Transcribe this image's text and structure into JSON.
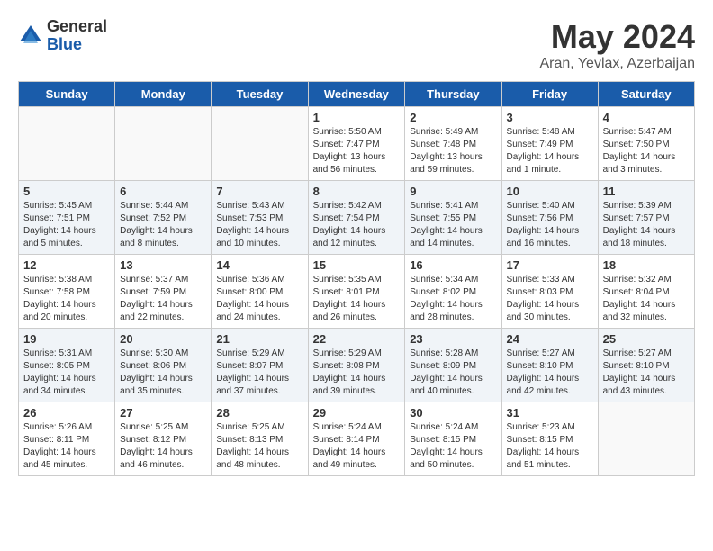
{
  "header": {
    "logo_general": "General",
    "logo_blue": "Blue",
    "month_year": "May 2024",
    "location": "Aran, Yevlax, Azerbaijan"
  },
  "weekdays": [
    "Sunday",
    "Monday",
    "Tuesday",
    "Wednesday",
    "Thursday",
    "Friday",
    "Saturday"
  ],
  "weeks": [
    [
      {
        "day": "",
        "info": ""
      },
      {
        "day": "",
        "info": ""
      },
      {
        "day": "",
        "info": ""
      },
      {
        "day": "1",
        "info": "Sunrise: 5:50 AM\nSunset: 7:47 PM\nDaylight: 13 hours\nand 56 minutes."
      },
      {
        "day": "2",
        "info": "Sunrise: 5:49 AM\nSunset: 7:48 PM\nDaylight: 13 hours\nand 59 minutes."
      },
      {
        "day": "3",
        "info": "Sunrise: 5:48 AM\nSunset: 7:49 PM\nDaylight: 14 hours\nand 1 minute."
      },
      {
        "day": "4",
        "info": "Sunrise: 5:47 AM\nSunset: 7:50 PM\nDaylight: 14 hours\nand 3 minutes."
      }
    ],
    [
      {
        "day": "5",
        "info": "Sunrise: 5:45 AM\nSunset: 7:51 PM\nDaylight: 14 hours\nand 5 minutes."
      },
      {
        "day": "6",
        "info": "Sunrise: 5:44 AM\nSunset: 7:52 PM\nDaylight: 14 hours\nand 8 minutes."
      },
      {
        "day": "7",
        "info": "Sunrise: 5:43 AM\nSunset: 7:53 PM\nDaylight: 14 hours\nand 10 minutes."
      },
      {
        "day": "8",
        "info": "Sunrise: 5:42 AM\nSunset: 7:54 PM\nDaylight: 14 hours\nand 12 minutes."
      },
      {
        "day": "9",
        "info": "Sunrise: 5:41 AM\nSunset: 7:55 PM\nDaylight: 14 hours\nand 14 minutes."
      },
      {
        "day": "10",
        "info": "Sunrise: 5:40 AM\nSunset: 7:56 PM\nDaylight: 14 hours\nand 16 minutes."
      },
      {
        "day": "11",
        "info": "Sunrise: 5:39 AM\nSunset: 7:57 PM\nDaylight: 14 hours\nand 18 minutes."
      }
    ],
    [
      {
        "day": "12",
        "info": "Sunrise: 5:38 AM\nSunset: 7:58 PM\nDaylight: 14 hours\nand 20 minutes."
      },
      {
        "day": "13",
        "info": "Sunrise: 5:37 AM\nSunset: 7:59 PM\nDaylight: 14 hours\nand 22 minutes."
      },
      {
        "day": "14",
        "info": "Sunrise: 5:36 AM\nSunset: 8:00 PM\nDaylight: 14 hours\nand 24 minutes."
      },
      {
        "day": "15",
        "info": "Sunrise: 5:35 AM\nSunset: 8:01 PM\nDaylight: 14 hours\nand 26 minutes."
      },
      {
        "day": "16",
        "info": "Sunrise: 5:34 AM\nSunset: 8:02 PM\nDaylight: 14 hours\nand 28 minutes."
      },
      {
        "day": "17",
        "info": "Sunrise: 5:33 AM\nSunset: 8:03 PM\nDaylight: 14 hours\nand 30 minutes."
      },
      {
        "day": "18",
        "info": "Sunrise: 5:32 AM\nSunset: 8:04 PM\nDaylight: 14 hours\nand 32 minutes."
      }
    ],
    [
      {
        "day": "19",
        "info": "Sunrise: 5:31 AM\nSunset: 8:05 PM\nDaylight: 14 hours\nand 34 minutes."
      },
      {
        "day": "20",
        "info": "Sunrise: 5:30 AM\nSunset: 8:06 PM\nDaylight: 14 hours\nand 35 minutes."
      },
      {
        "day": "21",
        "info": "Sunrise: 5:29 AM\nSunset: 8:07 PM\nDaylight: 14 hours\nand 37 minutes."
      },
      {
        "day": "22",
        "info": "Sunrise: 5:29 AM\nSunset: 8:08 PM\nDaylight: 14 hours\nand 39 minutes."
      },
      {
        "day": "23",
        "info": "Sunrise: 5:28 AM\nSunset: 8:09 PM\nDaylight: 14 hours\nand 40 minutes."
      },
      {
        "day": "24",
        "info": "Sunrise: 5:27 AM\nSunset: 8:10 PM\nDaylight: 14 hours\nand 42 minutes."
      },
      {
        "day": "25",
        "info": "Sunrise: 5:27 AM\nSunset: 8:10 PM\nDaylight: 14 hours\nand 43 minutes."
      }
    ],
    [
      {
        "day": "26",
        "info": "Sunrise: 5:26 AM\nSunset: 8:11 PM\nDaylight: 14 hours\nand 45 minutes."
      },
      {
        "day": "27",
        "info": "Sunrise: 5:25 AM\nSunset: 8:12 PM\nDaylight: 14 hours\nand 46 minutes."
      },
      {
        "day": "28",
        "info": "Sunrise: 5:25 AM\nSunset: 8:13 PM\nDaylight: 14 hours\nand 48 minutes."
      },
      {
        "day": "29",
        "info": "Sunrise: 5:24 AM\nSunset: 8:14 PM\nDaylight: 14 hours\nand 49 minutes."
      },
      {
        "day": "30",
        "info": "Sunrise: 5:24 AM\nSunset: 8:15 PM\nDaylight: 14 hours\nand 50 minutes."
      },
      {
        "day": "31",
        "info": "Sunrise: 5:23 AM\nSunset: 8:15 PM\nDaylight: 14 hours\nand 51 minutes."
      },
      {
        "day": "",
        "info": ""
      }
    ]
  ]
}
